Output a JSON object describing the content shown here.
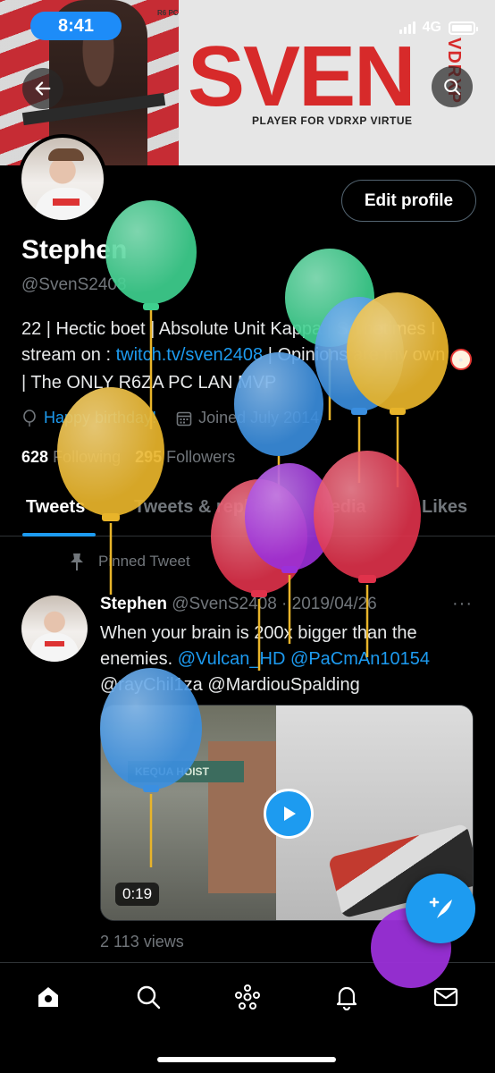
{
  "status_bar": {
    "time": "8:41",
    "network": "4G"
  },
  "banner": {
    "big_text": "SVEN",
    "vertical_text": "VDRXP",
    "subtitle": "PLAYER FOR VDRXP VIRTUE",
    "corner_text": "R6 PC"
  },
  "profile": {
    "edit_label": "Edit profile",
    "name": "Stephen",
    "handle": "@SvenS2408",
    "bio_1": "22 | Hectic boet | Absolute Unit Kappa | Sometimes I stream on : ",
    "bio_link": "twitch.tv/sven2408",
    "bio_2": " | Opinions are my own",
    "bio_3": " | The ONLY R6ZA PC LAN MVP",
    "birthday": "Happy birthday!",
    "joined": "Joined July 2014",
    "following_count": "628",
    "following_label": "Following",
    "followers_count": "295",
    "followers_label": "Followers"
  },
  "tabs": [
    {
      "label": "Tweets"
    },
    {
      "label": "Tweets & replies"
    },
    {
      "label": "Media"
    },
    {
      "label": "Likes"
    }
  ],
  "pinned_label": "Pinned Tweet",
  "tweet": {
    "name": "Stephen",
    "handle_date": "@SvenS2408 · 2019/04/26",
    "more": "···",
    "text_1": "When your brain is 200x bigger than the enemies. ",
    "mention_1": "@Vulcan_HD",
    "mention_2": "@PaCmAn10154",
    "text_2": "@rayChil1za @MardiouSpalding",
    "sign_text": "KEQUA HOIST",
    "duration": "0:19",
    "views": "2 113 views"
  },
  "colors": {
    "accent": "#1d9bf0",
    "background": "#000000",
    "muted_text": "#71767b",
    "balloon_green": "#3ecf8e",
    "balloon_blue": "#3b8fe0",
    "balloon_yellow": "#e8b42a",
    "balloon_red": "#e0324b",
    "balloon_purple": "#9b30d9"
  },
  "icons": {
    "back": "arrow-left-icon",
    "search": "search-icon",
    "balloon": "balloon-icon",
    "calendar": "calendar-icon",
    "pin": "pin-icon",
    "play": "play-icon",
    "compose": "compose-tweet-icon",
    "home": "home-icon",
    "explore": "search-icon",
    "spaces": "spaces-icon",
    "notifications": "bell-icon",
    "messages": "mail-icon"
  }
}
